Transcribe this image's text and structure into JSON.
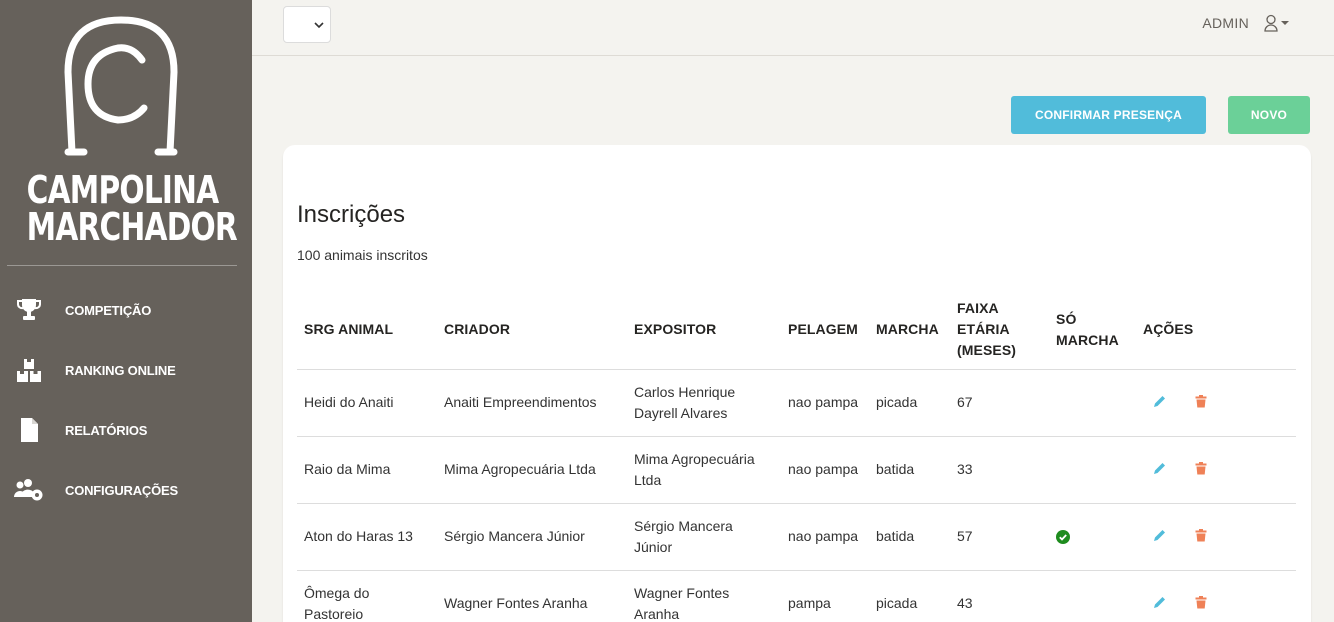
{
  "brand": {
    "line1": "CAMPOLINA",
    "line2": "MARCHADOR"
  },
  "sidebar": {
    "items": [
      {
        "label": "COMPETIÇÃO",
        "icon": "trophy-icon"
      },
      {
        "label": "RANKING ONLINE",
        "icon": "boxes-icon"
      },
      {
        "label": "RELATÓRIOS",
        "icon": "file-icon"
      },
      {
        "label": "CONFIGURAÇÕES",
        "icon": "users-cog-icon"
      }
    ]
  },
  "topbar": {
    "select_value": "",
    "user_name": "ADMIN"
  },
  "actions": {
    "confirm_label": "CONFIRMAR PRESENÇA",
    "new_label": "NOVO"
  },
  "main": {
    "title": "Inscrições",
    "subtitle": "100 animais inscritos",
    "columns": [
      "SRG ANIMAL",
      "CRIADOR",
      "EXPOSITOR",
      "PELAGEM",
      "MARCHA",
      "FAIXA ETÁRIA (MESES)",
      "SÓ MARCHA",
      "AÇÕES"
    ],
    "rows": [
      {
        "animal": "Heidi do Anaiti",
        "criador": "Anaiti Empreendimentos",
        "expositor": "Carlos Henrique Dayrell Alvares",
        "pelagem": "nao pampa",
        "marcha": "picada",
        "faixa": "67",
        "so_marcha": false
      },
      {
        "animal": "Raio da Mima",
        "criador": "Mima Agropecuária Ltda",
        "expositor": "Mima Agropecuária Ltda",
        "pelagem": "nao pampa",
        "marcha": "batida",
        "faixa": "33",
        "so_marcha": false
      },
      {
        "animal": "Aton do Haras 13",
        "criador": "Sérgio Mancera Júnior",
        "expositor": "Sérgio Mancera Júnior",
        "pelagem": "nao pampa",
        "marcha": "batida",
        "faixa": "57",
        "so_marcha": true
      },
      {
        "animal": "Ômega do Pastoreio",
        "criador": "Wagner Fontes Aranha",
        "expositor": "Wagner Fontes Aranha",
        "pelagem": "pampa",
        "marcha": "picada",
        "faixa": "43",
        "so_marcha": false
      }
    ]
  },
  "colors": {
    "sidebar": "#66615b",
    "info": "#51bcda",
    "success": "#6bd098",
    "danger": "#ef8157",
    "check": "#1e8c1e"
  }
}
